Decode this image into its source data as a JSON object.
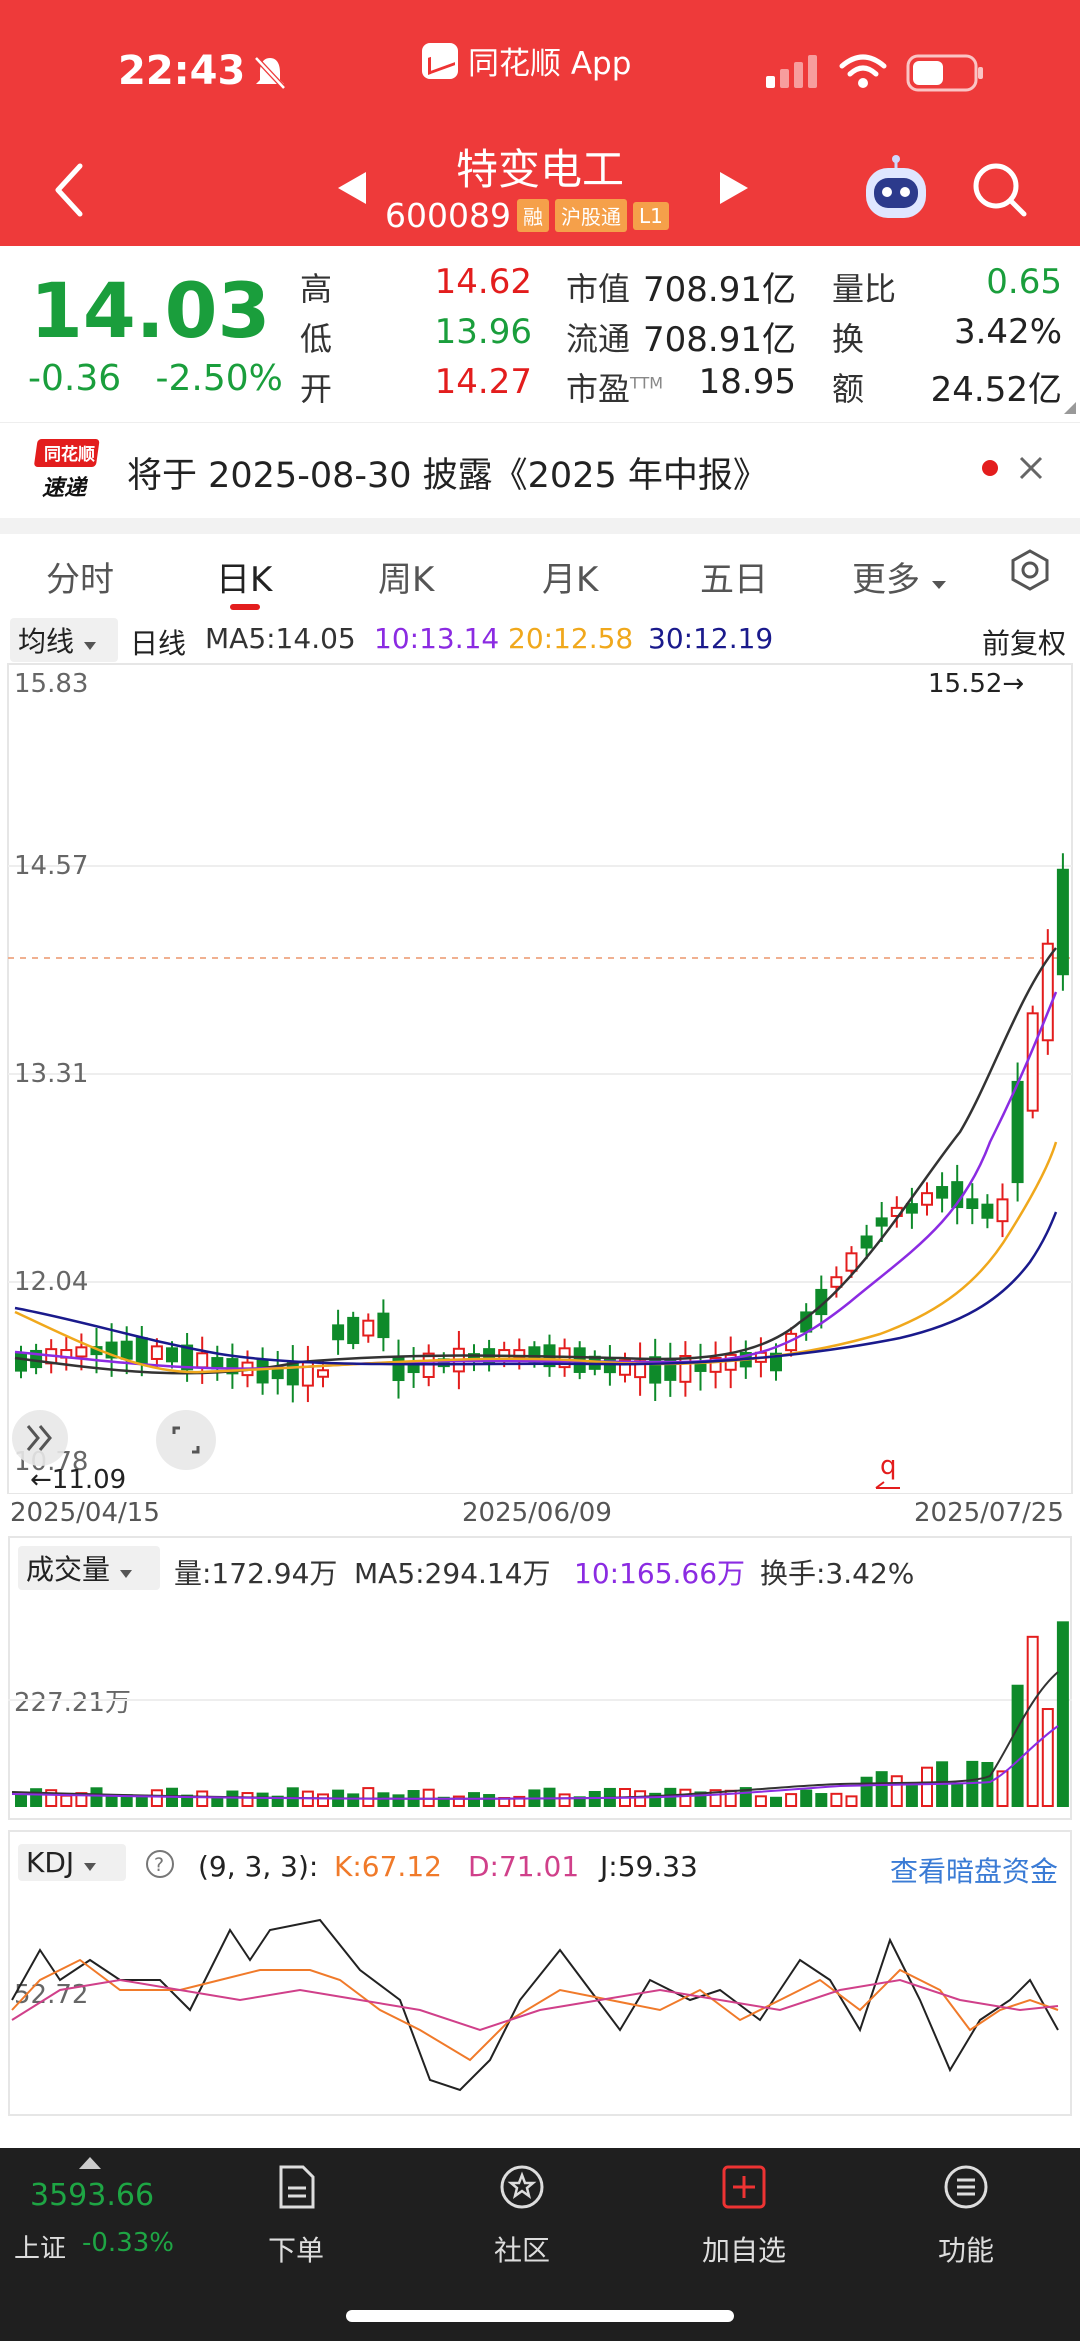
{
  "status": {
    "time": "22:43",
    "app_name": "同花顺 App"
  },
  "stock": {
    "name": "特变电工",
    "code": "600089",
    "badges": [
      "融",
      "沪股通",
      "L1"
    ]
  },
  "quote": {
    "price": "14.03",
    "change": "-0.36",
    "change_pct": "-2.50%",
    "high_label": "高",
    "high": "14.62",
    "low_label": "低",
    "low": "13.96",
    "open_label": "开",
    "open": "14.27",
    "mcap_label": "市值",
    "mcap": "708.91亿",
    "float_label": "流通",
    "float": "708.91亿",
    "pe_label": "市盈",
    "pe_sup": "TTM",
    "pe": "18.95",
    "vr_label": "量比",
    "vr": "0.65",
    "turnover_label": "换",
    "turnover": "3.42%",
    "amount_label": "额",
    "amount": "24.52亿"
  },
  "notice": {
    "logo_top": "同花顺",
    "logo_bottom": "速递",
    "text": "将于 2025-08-30 披露《2025 年中报》"
  },
  "tabs": [
    "分时",
    "日K",
    "周K",
    "月K",
    "五日",
    "更多"
  ],
  "ma_row": {
    "selector": "均线",
    "period": "日线",
    "ma5": "MA5:14.05",
    "ma10": "10:13.14",
    "ma20": "20:12.58",
    "ma30": "30:12.19",
    "adjust": "前复权"
  },
  "colors": {
    "up": "#e31d1d",
    "down": "#0e8a2a",
    "ma5": "#333333",
    "ma10": "#8b2be2",
    "ma20": "#f0a81c",
    "ma30": "#1a1a8c",
    "header": "#ee3a3a"
  },
  "kline": {
    "y_labels": [
      "15.83",
      "14.57",
      "13.31",
      "12.04",
      "10.78"
    ],
    "max_label": "15.52→",
    "min_label": "←11.09",
    "dates": [
      "2025/04/15",
      "2025/06/09",
      "2025/07/25"
    ]
  },
  "volume": {
    "selector": "成交量",
    "vol": "量:172.94万",
    "ma5": "MA5:294.14万",
    "ma10": "10:165.66万",
    "turnover": "换手:3.42%",
    "y_label": "227.21万"
  },
  "kdj": {
    "selector": "KDJ",
    "params": "(9, 3, 3):",
    "k": "K:67.12",
    "d": "D:71.01",
    "j": "J:59.33",
    "link": "查看暗盘资金",
    "y_label": "52.72"
  },
  "bottom_nav": {
    "index_value": "3593.66",
    "index_name": "上证",
    "index_change": "-0.33%",
    "items": [
      "下单",
      "社区",
      "加自选",
      "功能"
    ]
  }
}
